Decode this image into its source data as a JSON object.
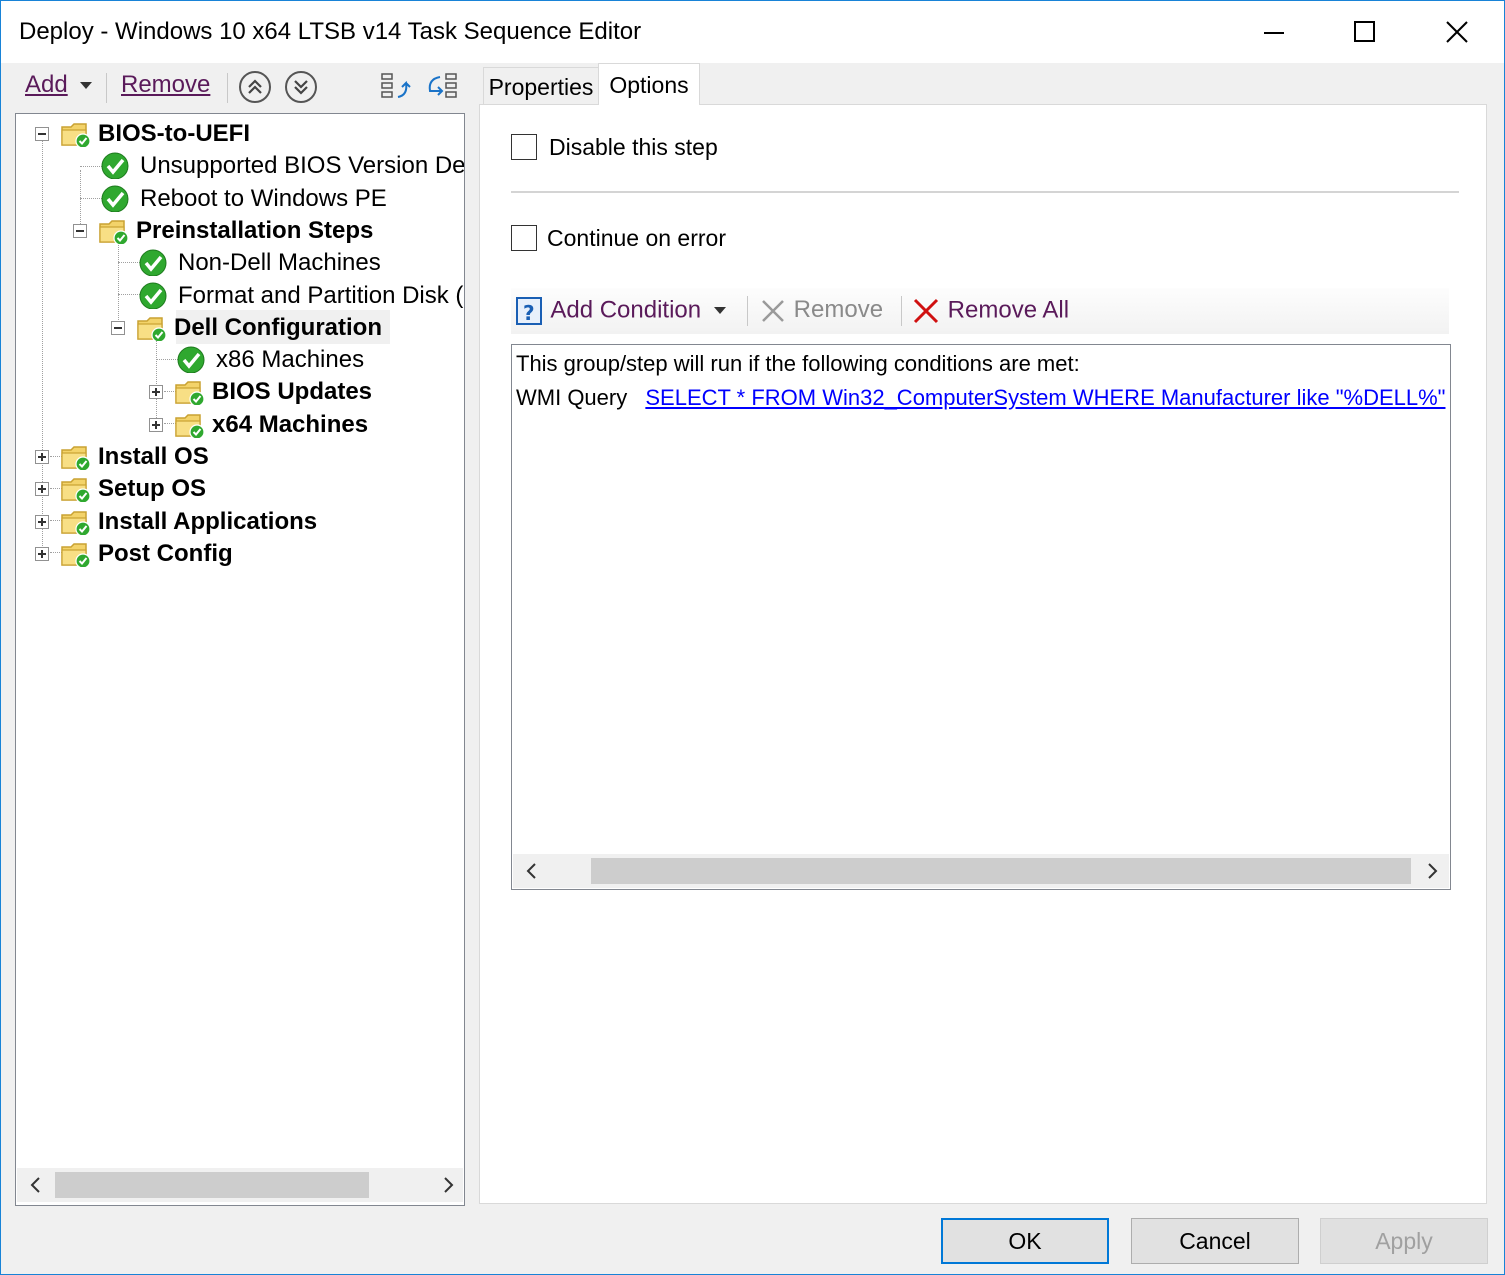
{
  "window": {
    "title": "Deploy - Windows 10 x64 LTSB v14 Task Sequence Editor"
  },
  "toolbar": {
    "add_label": "Add",
    "remove_label": "Remove"
  },
  "tree": {
    "items": [
      {
        "label": "BIOS-to-UEFI",
        "bold": true,
        "icon": "folder-check-icon",
        "expander": "minus"
      },
      {
        "label": "Unsupported BIOS Version Detec",
        "bold": false,
        "icon": "check-icon"
      },
      {
        "label": "Reboot to Windows PE",
        "bold": false,
        "icon": "check-icon"
      },
      {
        "label": "Preinstallation Steps",
        "bold": true,
        "icon": "folder-check-icon",
        "expander": "minus"
      },
      {
        "label": "Non-Dell Machines",
        "bold": false,
        "icon": "check-icon"
      },
      {
        "label": "Format and Partition Disk (Em",
        "bold": false,
        "icon": "check-icon"
      },
      {
        "label": "Dell Configuration",
        "bold": true,
        "icon": "folder-check-icon",
        "expander": "minus",
        "selected": true
      },
      {
        "label": "x86 Machines",
        "bold": false,
        "icon": "check-icon"
      },
      {
        "label": "BIOS Updates",
        "bold": true,
        "icon": "folder-check-icon",
        "expander": "plus"
      },
      {
        "label": "x64 Machines",
        "bold": true,
        "icon": "folder-check-icon",
        "expander": "plus"
      },
      {
        "label": "Install OS",
        "bold": true,
        "icon": "folder-check-icon",
        "expander": "plus"
      },
      {
        "label": "Setup OS",
        "bold": true,
        "icon": "folder-check-icon",
        "expander": "plus"
      },
      {
        "label": "Install Applications",
        "bold": true,
        "icon": "folder-check-icon",
        "expander": "plus"
      },
      {
        "label": "Post Config",
        "bold": true,
        "icon": "folder-check-icon",
        "expander": "plus"
      }
    ]
  },
  "tabs": {
    "properties": "Properties",
    "options": "Options",
    "active": "Options"
  },
  "options": {
    "disable_step_label": "Disable this step",
    "disable_step_checked": false,
    "continue_on_error_label": "Continue on error",
    "continue_on_error_checked": false
  },
  "conditions": {
    "add_condition_label": "Add Condition",
    "remove_label": "Remove",
    "remove_all_label": "Remove All",
    "header": "This group/step will run if the following conditions are met:",
    "rows": [
      {
        "type": "WMI Query",
        "value": "SELECT * FROM Win32_ComputerSystem WHERE Manufacturer like \"%DELL%\""
      }
    ]
  },
  "buttons": {
    "ok": "OK",
    "cancel": "Cancel",
    "apply": "Apply"
  },
  "colors": {
    "accent": "#0078d7",
    "link": "#0000ff",
    "check_green": "#2fa82f",
    "folder_yellow": "#f3d36a",
    "remove_red": "#d01010"
  }
}
